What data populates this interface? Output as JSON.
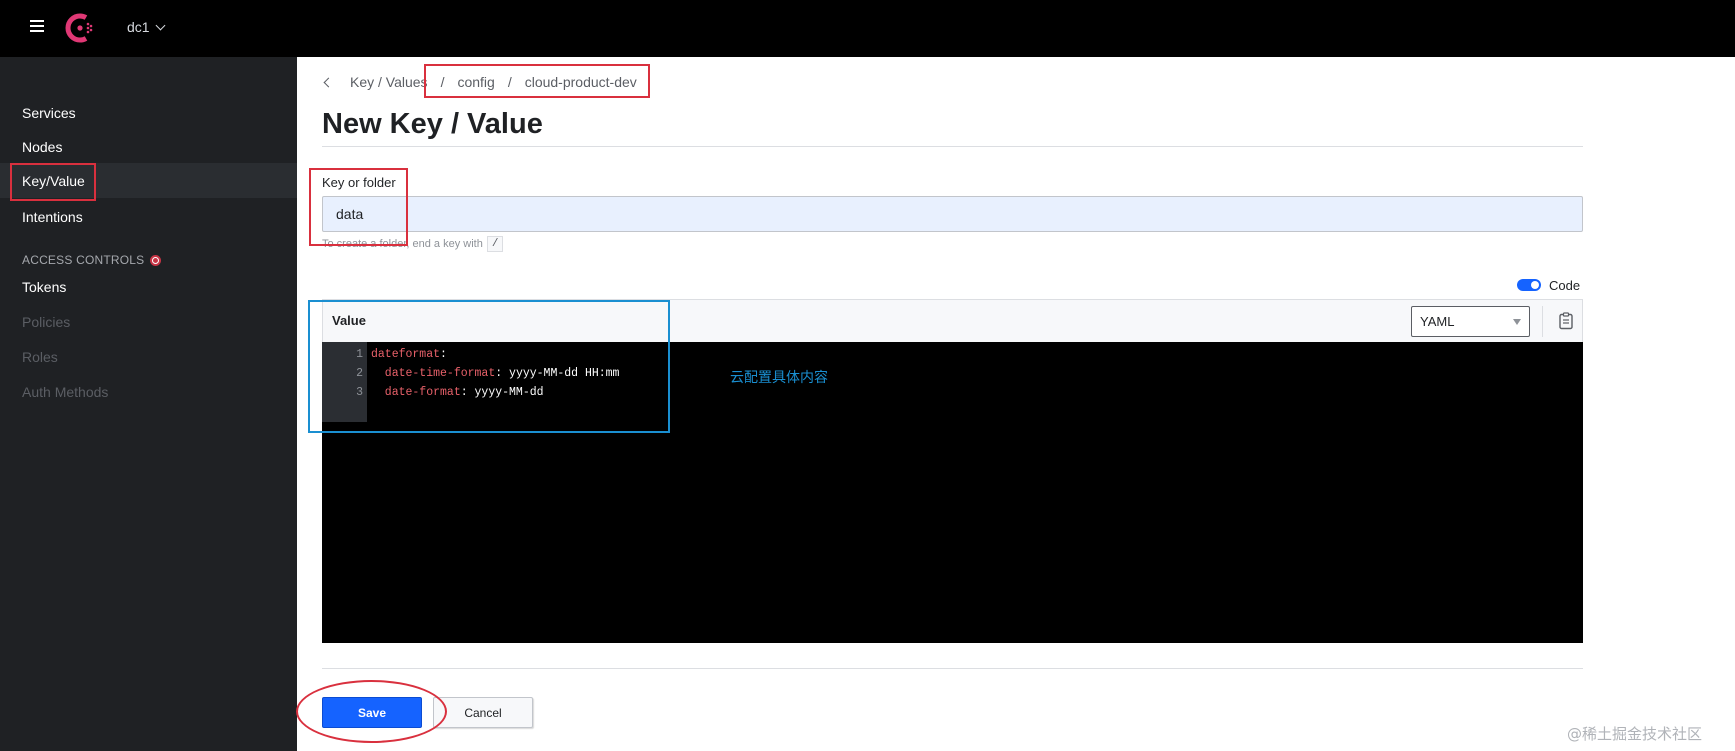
{
  "topbar": {
    "datacenter": "dc1",
    "icons": [
      "menu-icon",
      "consul-logo",
      "chevron-down-icon"
    ]
  },
  "sidebar": {
    "items": [
      {
        "label": "Services",
        "state": "enabled"
      },
      {
        "label": "Nodes",
        "state": "enabled"
      },
      {
        "label": "Key/Value",
        "state": "active"
      },
      {
        "label": "Intentions",
        "state": "enabled"
      }
    ],
    "access_controls": {
      "label": "ACCESS CONTROLS",
      "items": [
        {
          "label": "Tokens",
          "state": "enabled"
        },
        {
          "label": "Policies",
          "state": "disabled"
        },
        {
          "label": "Roles",
          "state": "disabled"
        },
        {
          "label": "Auth Methods",
          "state": "disabled"
        }
      ]
    }
  },
  "breadcrumb": {
    "root": "Key / Values",
    "separator": "/",
    "parts": [
      "config",
      "cloud-product-dev"
    ]
  },
  "page": {
    "title": "New Key / Value"
  },
  "form": {
    "key_label": "Key or folder",
    "key_value": "data",
    "help_text": "To create a folder, end a key with",
    "help_code": "/",
    "code_toggle_label": "Code",
    "code_toggle_on": true,
    "editor_title": "Value",
    "mode": "YAML",
    "code_lines": [
      {
        "no": "1",
        "key": "dateformat",
        "rest": ":"
      },
      {
        "no": "2",
        "key": "  date-time-format",
        "rest": ": yyyy-MM-dd HH:mm"
      },
      {
        "no": "3",
        "key": "  date-format",
        "rest": ": yyyy-MM-dd"
      }
    ],
    "save_label": "Save",
    "cancel_label": "Cancel"
  },
  "annotation": {
    "text": "云配置具体内容"
  },
  "watermark": "@稀土掘金技术社区",
  "colors": {
    "accent_blue": "#1563ff",
    "callout_red": "#d9303e",
    "callout_blue": "#1a8fd1",
    "yaml_key": "#e8616a"
  }
}
